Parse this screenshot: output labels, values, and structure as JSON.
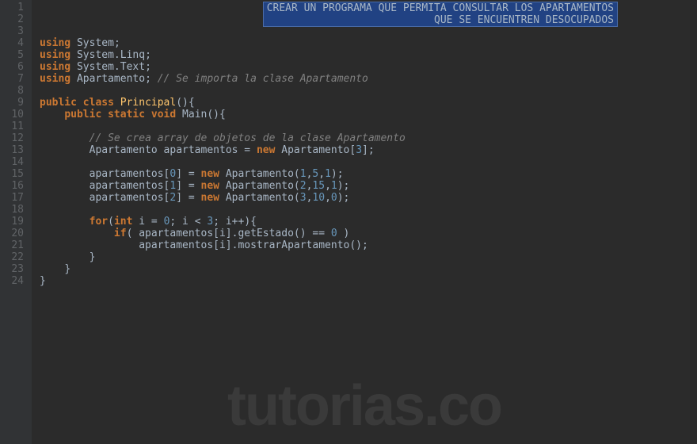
{
  "header_comment": {
    "line1": "CREAR UN PROGRAMA QUE PERMITA CONSULTAR LOS APARTAMENTOS",
    "line2": "QUE SE ENCUENTREN DESOCUPADOS"
  },
  "gutter": {
    "start": 1,
    "end": 24
  },
  "code": {
    "l4": {
      "kw": "using",
      "pkg": "System",
      "semi": ";"
    },
    "l5": {
      "kw": "using",
      "pkg": "System.Linq",
      "semi": ";"
    },
    "l6": {
      "kw": "using",
      "pkg": "System.Text",
      "semi": ";"
    },
    "l7": {
      "kw": "using",
      "pkg": "Apartamento",
      "semi": ";",
      "cmt": "// Se importa la clase Apartamento"
    },
    "l9": {
      "kw1": "public",
      "kw2": "class",
      "cls": "Principal",
      "rest": "(){"
    },
    "l10": {
      "kw1": "public",
      "kw2": "static",
      "kw3": "void",
      "method": "Main",
      "rest": "(){"
    },
    "l12": {
      "cmt": "// Se crea array de objetos de la clase Apartamento"
    },
    "l13": {
      "type": "Apartamento",
      "var": "apartamentos",
      "eq": " = ",
      "kw": "new",
      "ctor": "Apartamento",
      "open": "[",
      "num": "3",
      "close": "];"
    },
    "l15": {
      "var": "apartamentos",
      "open": "[",
      "idx": "0",
      "close": "]",
      "eq": " = ",
      "kw": "new",
      "ctor": "Apartamento",
      "popen": "(",
      "n1": "1",
      "c1": ",",
      "n2": "5",
      "c2": ",",
      "n3": "1",
      "pclose": ");"
    },
    "l16": {
      "var": "apartamentos",
      "open": "[",
      "idx": "1",
      "close": "]",
      "eq": " = ",
      "kw": "new",
      "ctor": "Apartamento",
      "popen": "(",
      "n1": "2",
      "c1": ",",
      "n2": "15",
      "c2": ",",
      "n3": "1",
      "pclose": ");"
    },
    "l17": {
      "var": "apartamentos",
      "open": "[",
      "idx": "2",
      "close": "]",
      "eq": " = ",
      "kw": "new",
      "ctor": "Apartamento",
      "popen": "(",
      "n1": "3",
      "c1": ",",
      "n2": "10",
      "c2": ",",
      "n3": "0",
      "pclose": ");"
    },
    "l19": {
      "kw1": "for",
      "open": "(",
      "kw2": "int",
      "var": " i = ",
      "n1": "0",
      "mid": "; i < ",
      "n2": "3",
      "rest": "; i++){"
    },
    "l20": {
      "kw": "if",
      "open": "( apartamentos[i].getEstado() == ",
      "num": "0",
      "close": " )"
    },
    "l21": {
      "txt": "apartamentos[i].mostrarApartamento();"
    },
    "l22": {
      "txt": "}"
    },
    "l23": {
      "txt": "}"
    },
    "l24": {
      "txt": "}"
    }
  },
  "watermark": "tutorias.co"
}
